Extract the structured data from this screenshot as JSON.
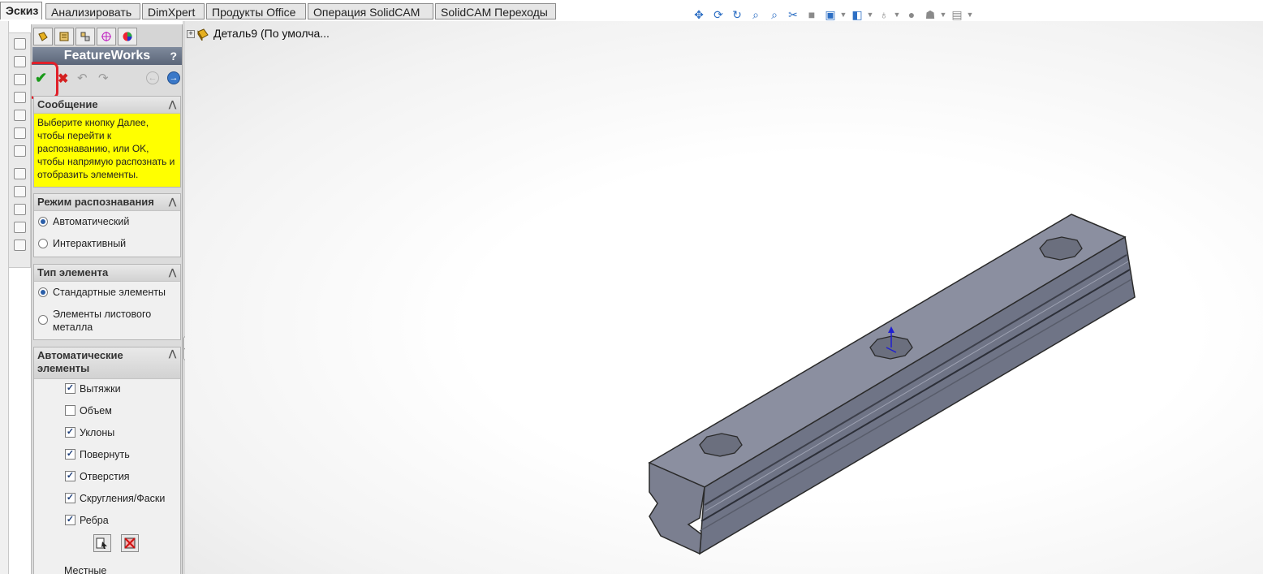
{
  "tabs": [
    {
      "label": "Эскиз",
      "active": true
    },
    {
      "label": "Анализировать"
    },
    {
      "label": "DimXpert"
    },
    {
      "label": "Продукты Office"
    },
    {
      "label": "Операция  SolidCAM"
    },
    {
      "label": "SolidCAM Переходы"
    }
  ],
  "property_manager": {
    "title": "FeatureWorks",
    "help": "?",
    "message": {
      "header": "Сообщение",
      "text": "Выберите кнопку Далее, чтобы перейти к распознаванию, или OK, чтобы напрямую распознать и отобразить элементы."
    },
    "recognition_mode": {
      "header": "Режим распознавания",
      "options": [
        {
          "label": "Автоматический",
          "selected": true
        },
        {
          "label": "Интерактивный",
          "selected": false
        }
      ]
    },
    "feature_type": {
      "header": "Тип элемента",
      "options": [
        {
          "label": "Стандартные элементы",
          "selected": true
        },
        {
          "label": "Элементы листового металла",
          "selected": false
        }
      ]
    },
    "auto_features": {
      "header": "Автоматические элементы",
      "items": [
        {
          "label": "Вытяжки",
          "checked": true
        },
        {
          "label": "Объем",
          "checked": false
        },
        {
          "label": "Уклоны",
          "checked": true
        },
        {
          "label": "Повернуть",
          "checked": true
        },
        {
          "label": "Отверстия",
          "checked": true
        },
        {
          "label": "Скругления/Фаски",
          "checked": true
        },
        {
          "label": "Ребра",
          "checked": true
        }
      ],
      "check_glyph": "✓"
    },
    "local_label": "Местные"
  },
  "feature_tree": {
    "expand": "+",
    "part_name": "Деталь9  (По умолча..."
  },
  "colors": {
    "message_bg": "#ffff00",
    "highlight": "#e0202a",
    "part": "#7d8294",
    "hud_icon": "#2d6fc4"
  }
}
